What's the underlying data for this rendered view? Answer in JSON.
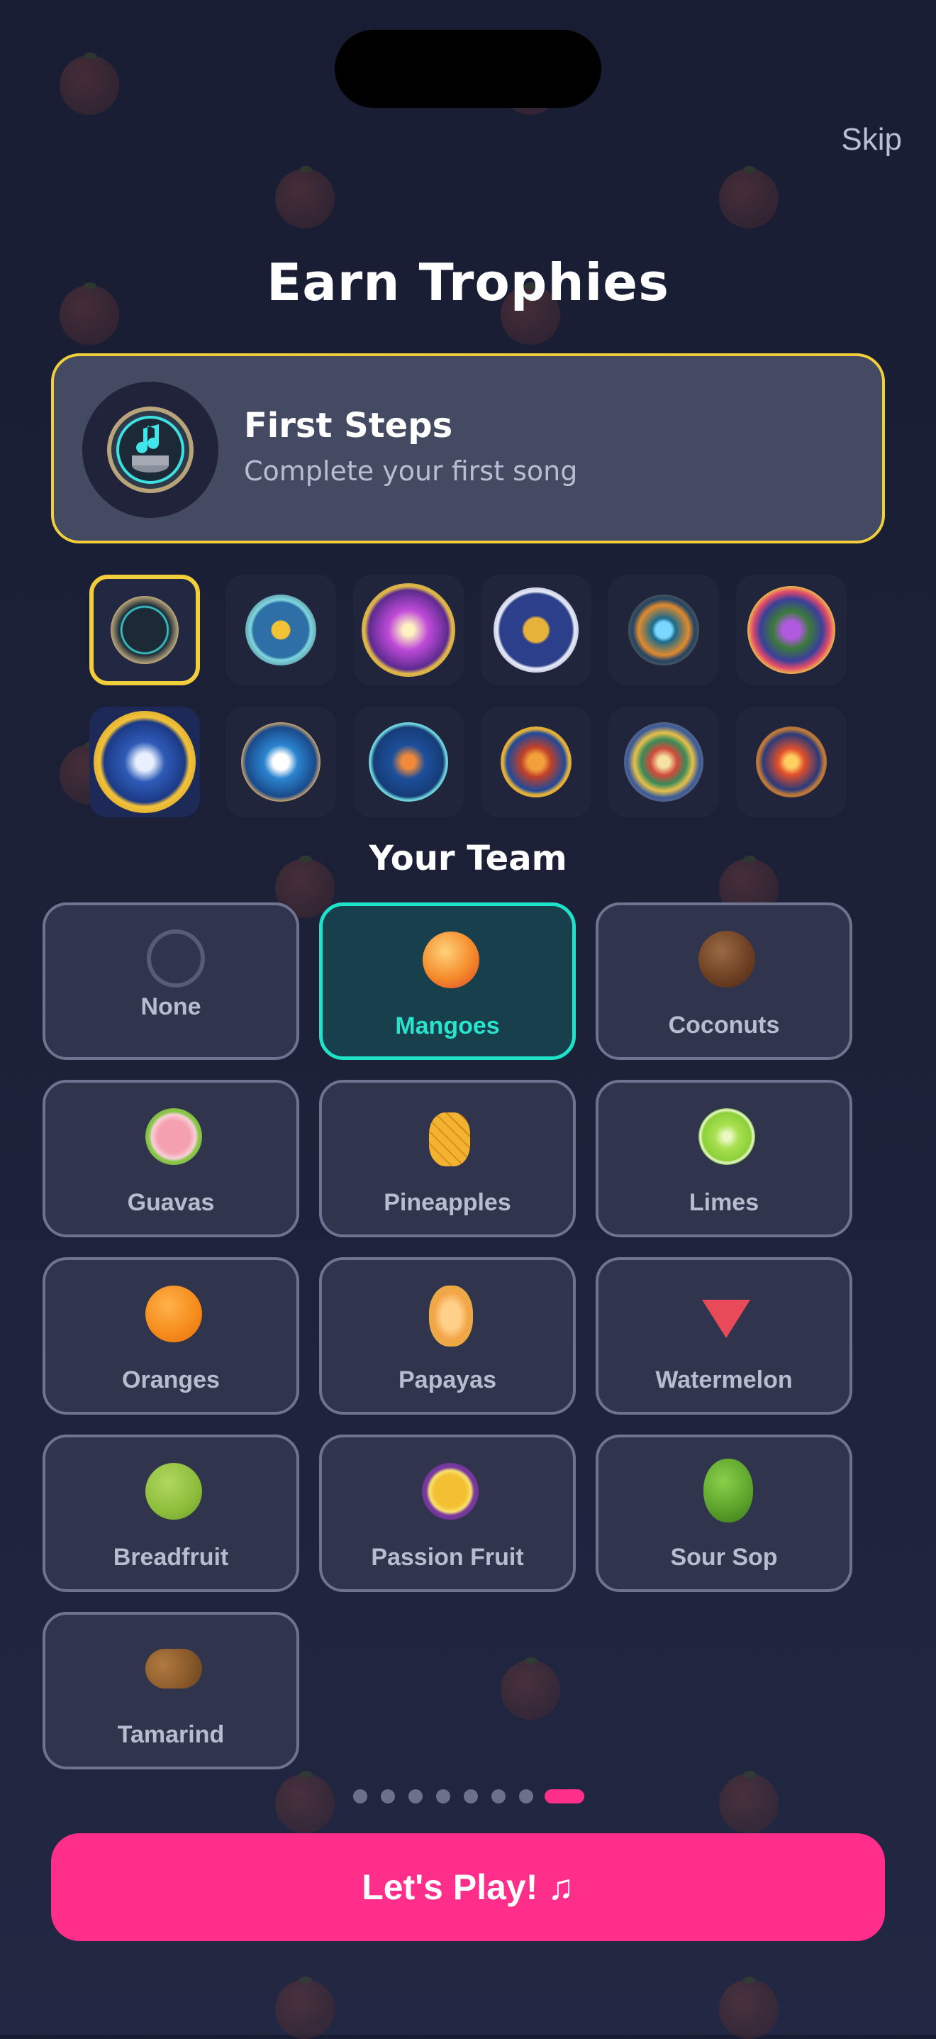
{
  "header": {
    "skip_label": "Skip",
    "title": "Earn Trophies"
  },
  "trophy_card": {
    "name": "First Steps",
    "description": "Complete your first song",
    "icon": "music-note-medal-icon"
  },
  "trophies": {
    "selected_index": 0,
    "items": [
      {
        "icon": "music-note-medal-icon"
      },
      {
        "icon": "star-medal-icon"
      },
      {
        "icon": "fireworks-medal-icon"
      },
      {
        "icon": "trophy-cup-medal-icon"
      },
      {
        "icon": "diamond-medal-icon"
      },
      {
        "icon": "gem-wreath-medal-icon"
      },
      {
        "icon": "shield-check-medal-icon"
      },
      {
        "icon": "cloud-arrow-medal-icon"
      },
      {
        "icon": "comet-medal-icon"
      },
      {
        "icon": "phoenix-medal-icon"
      },
      {
        "icon": "compass-star-medal-icon"
      },
      {
        "icon": "flame-medal-icon"
      }
    ]
  },
  "team": {
    "title": "Your Team",
    "selected": "Mangoes",
    "options": [
      {
        "label": "None"
      },
      {
        "label": "Mangoes"
      },
      {
        "label": "Coconuts"
      },
      {
        "label": "Guavas"
      },
      {
        "label": "Pineapples"
      },
      {
        "label": "Limes"
      },
      {
        "label": "Oranges"
      },
      {
        "label": "Papayas"
      },
      {
        "label": "Watermelon"
      },
      {
        "label": "Breadfruit"
      },
      {
        "label": "Passion Fruit"
      },
      {
        "label": "Sour Sop"
      },
      {
        "label": "Tamarind"
      }
    ]
  },
  "pagination": {
    "count": 8,
    "active_index": 7
  },
  "play_button": {
    "label": "Let's Play!  ♫"
  },
  "colors": {
    "accent": "#ff2e8b",
    "selected_trophy": "#f2cf3a",
    "selected_team": "#1fe2c8"
  }
}
